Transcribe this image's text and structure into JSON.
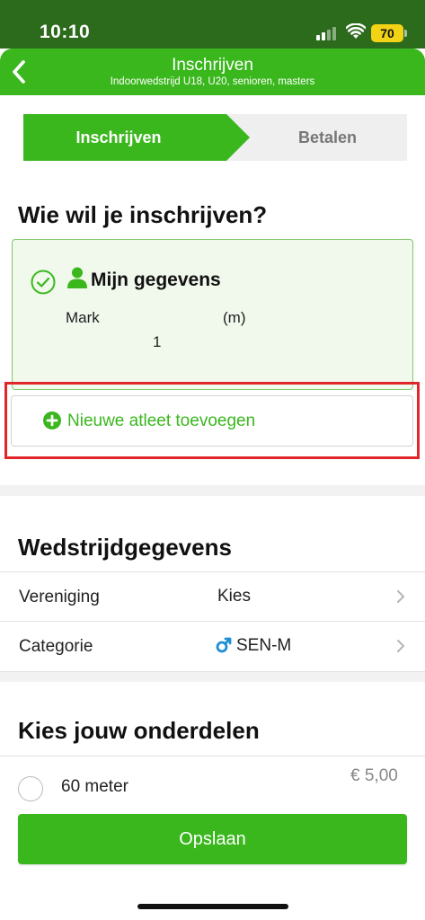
{
  "status_bar": {
    "time": "10:10",
    "battery": "70"
  },
  "nav": {
    "title": "Inschrijven",
    "subtitle": "Indoorwedstrijd U18, U20, senioren, masters"
  },
  "steps": [
    {
      "label": "Inschrijven",
      "active": true
    },
    {
      "label": "Betalen",
      "active": false
    }
  ],
  "who": {
    "heading": "Wie wil je inschrijven?",
    "card_title": "Mijn gegevens",
    "name": "Mark",
    "gender": "(m)",
    "number": "1",
    "add_label": "Nieuwe atleet toevoegen"
  },
  "competition": {
    "heading": "Wedstrijdgegevens",
    "rows": [
      {
        "label": "Vereniging",
        "value": "Kies"
      },
      {
        "label": "Categorie",
        "value": "SEN-M"
      }
    ]
  },
  "events": {
    "heading": "Kies jouw onderdelen",
    "items": [
      {
        "label": "60 meter",
        "price": "€ 5,00"
      }
    ]
  },
  "save_label": "Opslaan",
  "colors": {
    "brand_green": "#3bb71e",
    "status_bar_green": "#2c6a1c",
    "highlight_red": "#e0262b",
    "gender_blue": "#1d8fd6"
  }
}
